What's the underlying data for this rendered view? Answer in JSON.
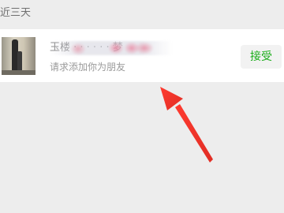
{
  "section": {
    "title": "近三天"
  },
  "request": {
    "name": "玉楼 · · · · · · 梦",
    "message": "请求添加你为朋友",
    "accept_label": "接受"
  },
  "colors": {
    "accent_green": "#1aad19",
    "background": "#ededed",
    "arrow_red": "#e8362b"
  },
  "icons": {
    "annotation": "red-arrow-pointer-icon"
  }
}
